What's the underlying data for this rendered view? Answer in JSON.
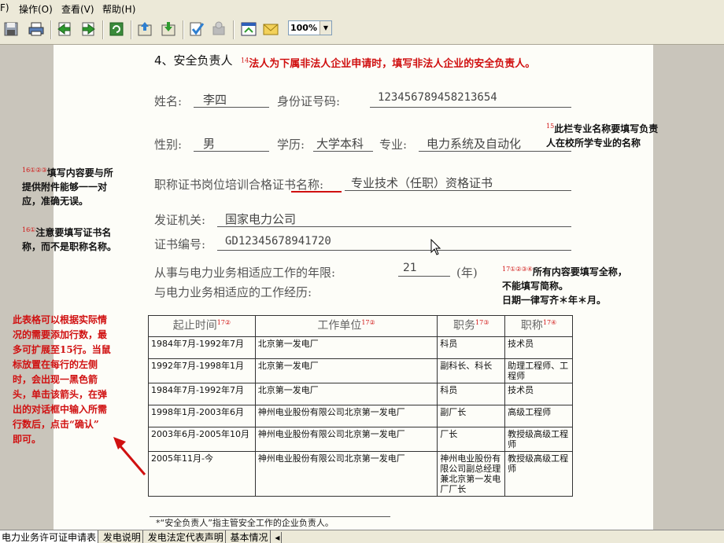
{
  "menu": {
    "file_partial": "F)",
    "operate": "操作(O)",
    "view": "查看(V)",
    "help": "帮助(H)"
  },
  "toolbar": {
    "zoom": "100%"
  },
  "form": {
    "section_title": "4、安全负责人",
    "section_note": "法人为下属非法人企业申请时，填写非法人企业的安全负责人。",
    "name_label": "姓名:",
    "name_value": "李四",
    "id_label": "身份证号码:",
    "id_value": "123456789458213654",
    "gender_label": "性别:",
    "gender_value": "男",
    "edu_label": "学历:",
    "edu_value": "大学本科",
    "major_label": "专业:",
    "major_value": "电力系统及自动化",
    "cert_name_label": "职称证书岗位培训合格证书名称:",
    "cert_name_value": "专业技术（任职）资格证书",
    "issuer_label": "发证机关:",
    "issuer_value": "国家电力公司",
    "cert_no_label": "证书编号:",
    "cert_no_value": "GD12345678941720",
    "years_label": "从事与电力业务相适应工作的年限:",
    "years_value": "21",
    "years_unit": "(年)",
    "exp_label": "与电力业务相适应的工作经历:",
    "footnote": "*“安全负责人”指主管安全工作的企业负责人。"
  },
  "table": {
    "headers": [
      "起止时间",
      "工作单位",
      "职务",
      "职称"
    ],
    "rows": [
      [
        "1984年7月-1992年7月",
        "北京第一发电厂",
        "科员",
        "技术员"
      ],
      [
        "1992年7月-1998年1月",
        "北京第一发电厂",
        "副科长、科长",
        "助理工程师、工程师"
      ],
      [
        "1984年7月-1992年7月",
        "北京第一发电厂",
        "科员",
        "技术员"
      ],
      [
        "1998年1月-2003年6月",
        "神州电业股份有限公司北京第一发电厂",
        "副厂长",
        "高级工程师"
      ],
      [
        "2003年6月-2005年10月",
        "神州电业股份有限公司北京第一发电厂",
        "厂长",
        "教授级高级工程师"
      ],
      [
        "2005年11月-今",
        "神州电业股份有限公司北京第一发电厂",
        "神州电业股份有限公司副总经理兼北京第一发电厂厂长",
        "教授级高级工程师"
      ]
    ]
  },
  "annotations": {
    "major_note_1": "此栏专业名称要填写负责",
    "major_note_2": "人在校所学专业的名称",
    "attach_note_1": "填写内容要与所",
    "attach_note_2": "提供附件能够一一对",
    "attach_note_3": "应，准确无误。",
    "cert_note_1": "注意要填写证书名",
    "cert_note_2": "称，而不是职称名称。",
    "fullname_note_1": "所有内容要填写全称，",
    "fullname_note_2": "不能填写简称。",
    "fullname_note_3": "日期一律写齐＊年＊月。",
    "rows_note": [
      "此表格可以根据实际情",
      "况的需要添加行数，最",
      "多可扩展至15行。当鼠",
      "标放置在每行的左侧",
      "时，会出现一黑色箭",
      "头，单击该箭头，在弹",
      "出的对话框中输入所需",
      "行数后，点击“确认”",
      "即可。"
    ]
  },
  "tabs": [
    "电力业务许可证申请表",
    "发电说明",
    "发电法定代表声明",
    "基本情况"
  ]
}
